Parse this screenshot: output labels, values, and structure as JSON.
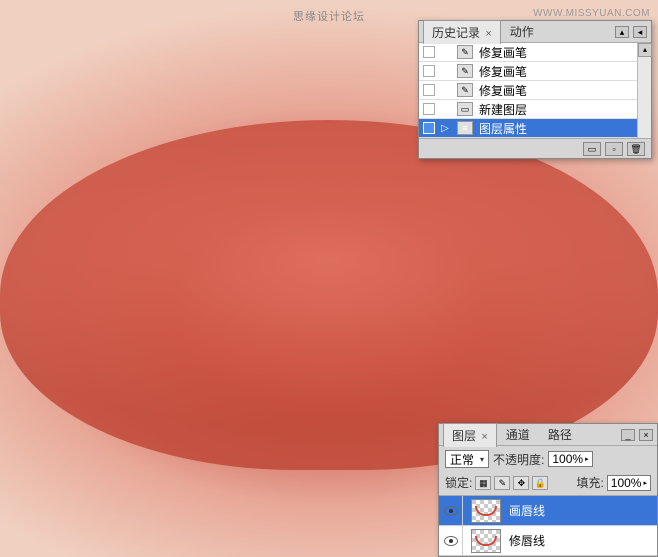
{
  "watermark": {
    "text": "思缘设计论坛",
    "url": "WWW.MISSYUAN.COM"
  },
  "history_panel": {
    "tabs": [
      {
        "label": "历史记录",
        "active": true
      },
      {
        "label": "动作",
        "active": false
      }
    ],
    "items": [
      {
        "label": "修复画笔",
        "icon": "brush",
        "selected": false,
        "pointer": ""
      },
      {
        "label": "修复画笔",
        "icon": "brush",
        "selected": false,
        "pointer": ""
      },
      {
        "label": "修复画笔",
        "icon": "brush",
        "selected": false,
        "pointer": ""
      },
      {
        "label": "新建图层",
        "icon": "layer",
        "selected": false,
        "pointer": ""
      },
      {
        "label": "图层属性",
        "icon": "props",
        "selected": true,
        "pointer": "▷"
      }
    ]
  },
  "layers_panel": {
    "tabs": [
      {
        "label": "图层",
        "active": true
      },
      {
        "label": "通道",
        "active": false
      },
      {
        "label": "路径",
        "active": false
      }
    ],
    "blend_mode": "正常",
    "opacity_label": "不透明度:",
    "opacity_value": "100%",
    "lock_label": "锁定:",
    "fill_label": "填充:",
    "fill_value": "100%",
    "layers": [
      {
        "name": "画唇线",
        "visible": true,
        "selected": true
      },
      {
        "name": "修唇线",
        "visible": true,
        "selected": false
      }
    ]
  }
}
